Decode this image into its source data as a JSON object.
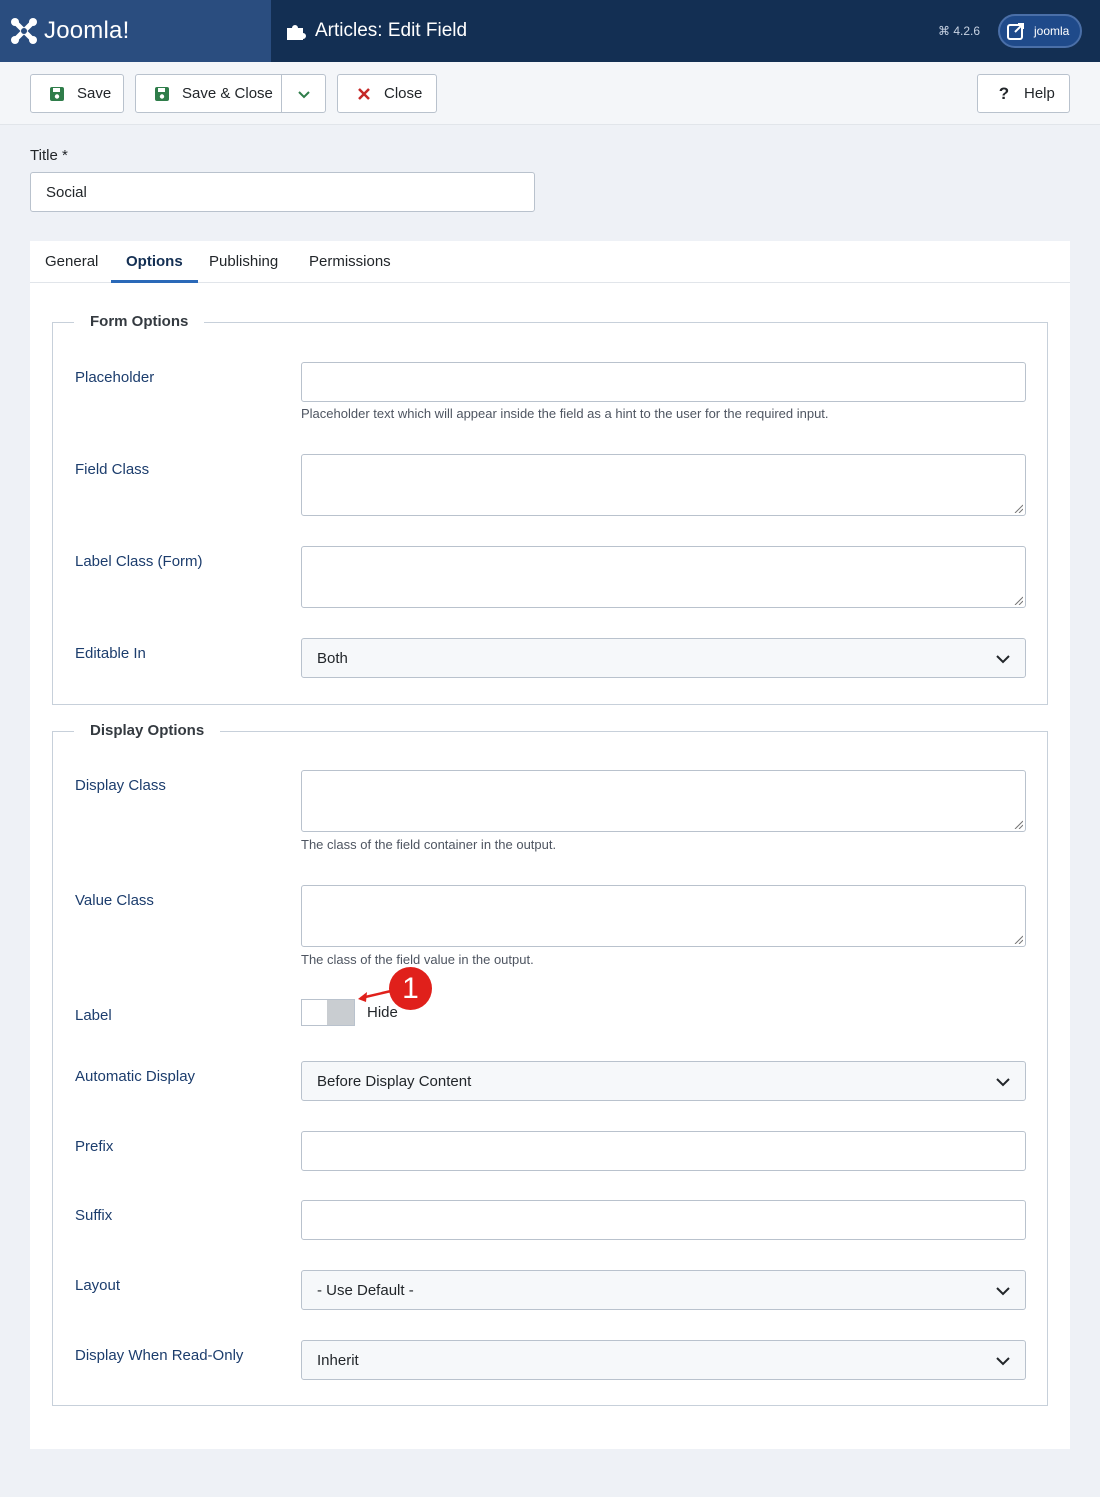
{
  "header": {
    "logo_text": "Joomla!",
    "page_title": "Articles: Edit Field",
    "version": "4.2.6",
    "user_label": "joomla"
  },
  "toolbar": {
    "save_label": "Save",
    "save_close_label": "Save & Close",
    "close_label": "Close",
    "help_label": "Help"
  },
  "title_field": {
    "label": "Title *",
    "value": "Social"
  },
  "tabs": [
    {
      "label": "General"
    },
    {
      "label": "Options"
    },
    {
      "label": "Publishing"
    },
    {
      "label": "Permissions"
    }
  ],
  "form_options": {
    "legend": "Form Options",
    "placeholder_label": "Placeholder",
    "placeholder_hint": "Placeholder text which will appear inside the field as a hint to the user for the required input.",
    "field_class_label": "Field Class",
    "label_class_label": "Label Class (Form)",
    "editable_in_label": "Editable In",
    "editable_in_value": "Both"
  },
  "display_options": {
    "legend": "Display Options",
    "display_class_label": "Display Class",
    "display_class_hint": "The class of the field container in the output.",
    "value_class_label": "Value Class",
    "value_class_hint": "The class of the field value in the output.",
    "label_label": "Label",
    "label_toggle_value": "Hide",
    "automatic_display_label": "Automatic Display",
    "automatic_display_value": "Before Display Content",
    "prefix_label": "Prefix",
    "suffix_label": "Suffix",
    "layout_label": "Layout",
    "layout_value": "- Use Default -",
    "read_only_label": "Display When Read-Only",
    "read_only_value": "Inherit"
  },
  "annotation": {
    "number": "1"
  },
  "colors": {
    "header_bg": "#132f53",
    "logo_bg": "#2a4d7f",
    "save_icon": "#2f7d4a",
    "close_icon": "#c52827",
    "callout": "#e0201b"
  }
}
